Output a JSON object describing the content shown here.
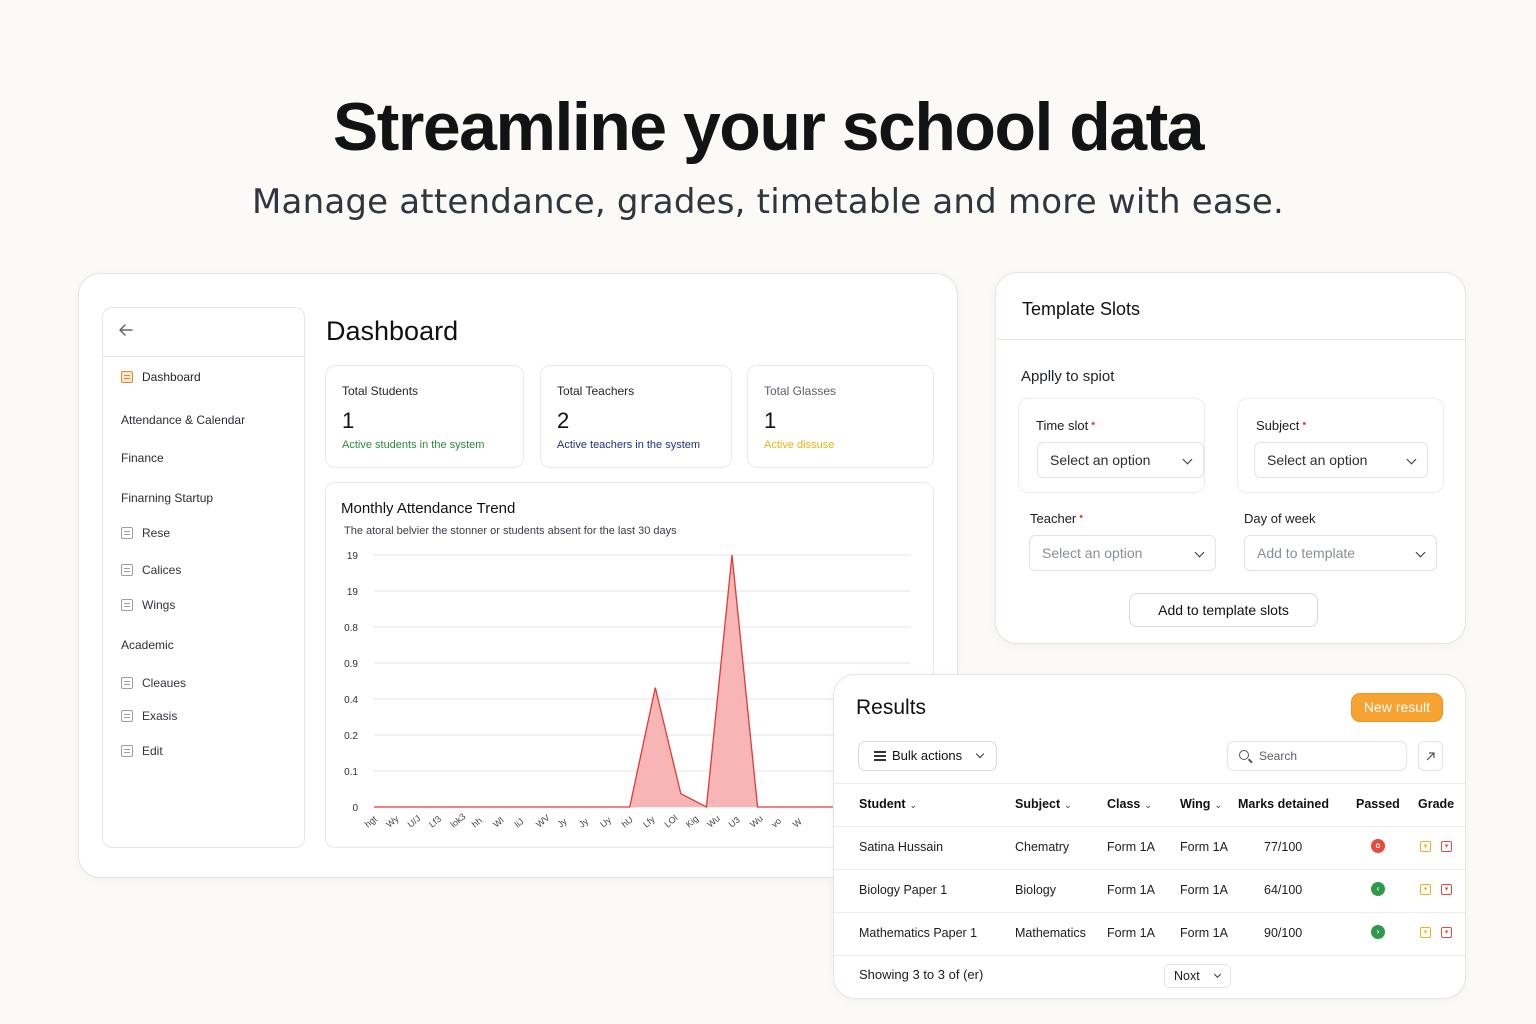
{
  "hero": {
    "title": "Streamline your school data",
    "subtitle": "Manage attendance, grades, timetable and more with ease."
  },
  "sidebar": {
    "items": [
      {
        "label": "Dashboard",
        "icon": "dashboard-icon",
        "active": true
      },
      {
        "label": "Attendance & Calendar"
      },
      {
        "label": "Finance"
      },
      {
        "label": "Finarning Startup"
      },
      {
        "label": "Rese",
        "icon": "list-icon"
      },
      {
        "label": "Calices",
        "icon": "folder-icon"
      },
      {
        "label": "Wings",
        "icon": "calendar-icon"
      },
      {
        "label": "Academic"
      },
      {
        "label": "Cleaues",
        "icon": "book-icon"
      },
      {
        "label": "Exasis",
        "icon": "clipboard-icon"
      },
      {
        "label": "Edit",
        "icon": "edit-icon"
      }
    ]
  },
  "dashboard": {
    "title": "Dashboard",
    "stats": [
      {
        "label": "Total Students",
        "value": "1",
        "note": "Active students in the system",
        "note_color": "#2e8b3a"
      },
      {
        "label": "Total Teachers",
        "value": "2",
        "note": "Active teachers in the system",
        "note_color": "#1f2f8a"
      },
      {
        "label": "Total Glasses",
        "value": "1",
        "note": "Active dissuse",
        "note_color": "#e8b21a"
      }
    ]
  },
  "chart_data": {
    "type": "area",
    "title": "Monthly Attendance Trend",
    "subtitle": "The atoral belvier the stonner or students absent for the last 30 days",
    "y_tick_labels": [
      "19",
      "19",
      "0.8",
      "0.9",
      "0.4",
      "0.2",
      "0.1",
      "0"
    ],
    "x_tick_labels": [
      "hgt",
      "Wy",
      "U/J",
      "Lf3",
      "lok3",
      "hh",
      "Wl",
      "liJ",
      "WV",
      "Jy",
      "Jy",
      "Uy",
      "hU",
      "Lfy",
      "LOl",
      "Kig",
      "Wu",
      "U3",
      "Wu",
      "vo",
      "W"
    ],
    "series": [
      {
        "values": [
          0,
          0,
          0,
          0,
          0,
          0,
          0,
          0,
          0,
          0,
          0,
          0.9,
          0.1,
          0,
          1.9,
          0,
          0,
          0,
          0,
          0,
          0,
          0
        ],
        "color": "#e03a3a",
        "fill": "#f7b5b5"
      }
    ],
    "grid": true
  },
  "template_slots": {
    "title": "Template Slots",
    "subtitle": "Applly to spiot",
    "time_slot": {
      "label": "Time slot",
      "value": "Select an option"
    },
    "subject": {
      "label": "Subject",
      "value": "Select an option"
    },
    "teacher": {
      "label": "Teacher",
      "value": "Select an option"
    },
    "day_of_week": {
      "label": "Day of week",
      "value": "Add to template"
    },
    "add_button": "Add to template slots"
  },
  "results": {
    "title": "Results",
    "new_button": "New result",
    "bulk_actions": "Bulk actions",
    "search_placeholder": "Search",
    "columns": [
      "Student",
      "Subject",
      "Class",
      "Wing",
      "Marks detained",
      "Passed",
      "Grade"
    ],
    "rows": [
      {
        "student": "Satina Hussain",
        "subject": "Chematry",
        "class": "Form 1A",
        "wing": "Form 1A",
        "marks": "77/100",
        "passed_color": "#e94a3a"
      },
      {
        "student": "Biology Paper 1",
        "subject": "Biology",
        "class": "Form 1A",
        "wing": "Form 1A",
        "marks": "64/100",
        "passed_color": "#2f9a4a"
      },
      {
        "student": "Mathematics Paper 1",
        "subject": "Mathematics",
        "class": "Form 1A",
        "wing": "Form 1A",
        "marks": "90/100",
        "passed_color": "#2f9a4a"
      }
    ],
    "footer": "Showing 3 to 3 of (er)",
    "next_button": "Noxt",
    "colors": {
      "accent": "#f7a331",
      "grade_yellow": "#e8b21a",
      "grade_red": "#e94a3a"
    }
  }
}
